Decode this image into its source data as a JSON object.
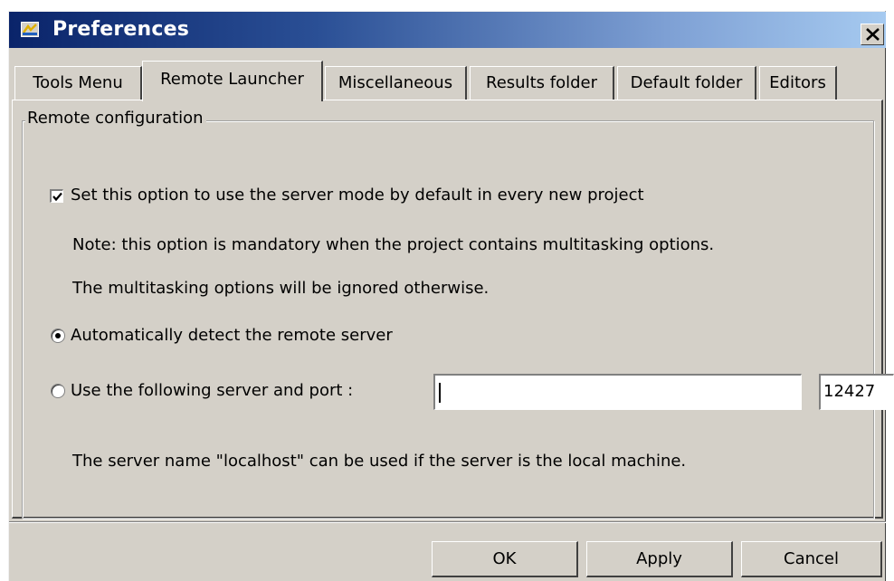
{
  "window": {
    "title": "Preferences",
    "close_label": "close"
  },
  "tabs": [
    {
      "label": "Tools Menu",
      "active": false
    },
    {
      "label": "Remote Launcher",
      "active": true
    },
    {
      "label": "Miscellaneous",
      "active": false
    },
    {
      "label": "Results folder",
      "active": false
    },
    {
      "label": "Default folder",
      "active": false
    },
    {
      "label": "Editors",
      "active": false
    }
  ],
  "remote_config": {
    "group_title": "Remote configuration",
    "server_mode_checkbox": {
      "label": "Set this option to use the server mode by default in every new project",
      "checked": true
    },
    "note_line1": "Note: this option is mandatory when the project contains multitasking options.",
    "note_line2": "The multitasking options will be ignored otherwise.",
    "auto_detect_radio": {
      "label": "Automatically detect the remote server",
      "selected": true
    },
    "manual_server_radio": {
      "label": "Use the following server and port :",
      "selected": false
    },
    "server_input_value": "",
    "port_input_value": "12427",
    "localhost_hint": "The server name \"localhost\" can be used if the server is the local machine."
  },
  "buttons": {
    "ok": "OK",
    "apply": "Apply",
    "cancel": "Cancel"
  }
}
